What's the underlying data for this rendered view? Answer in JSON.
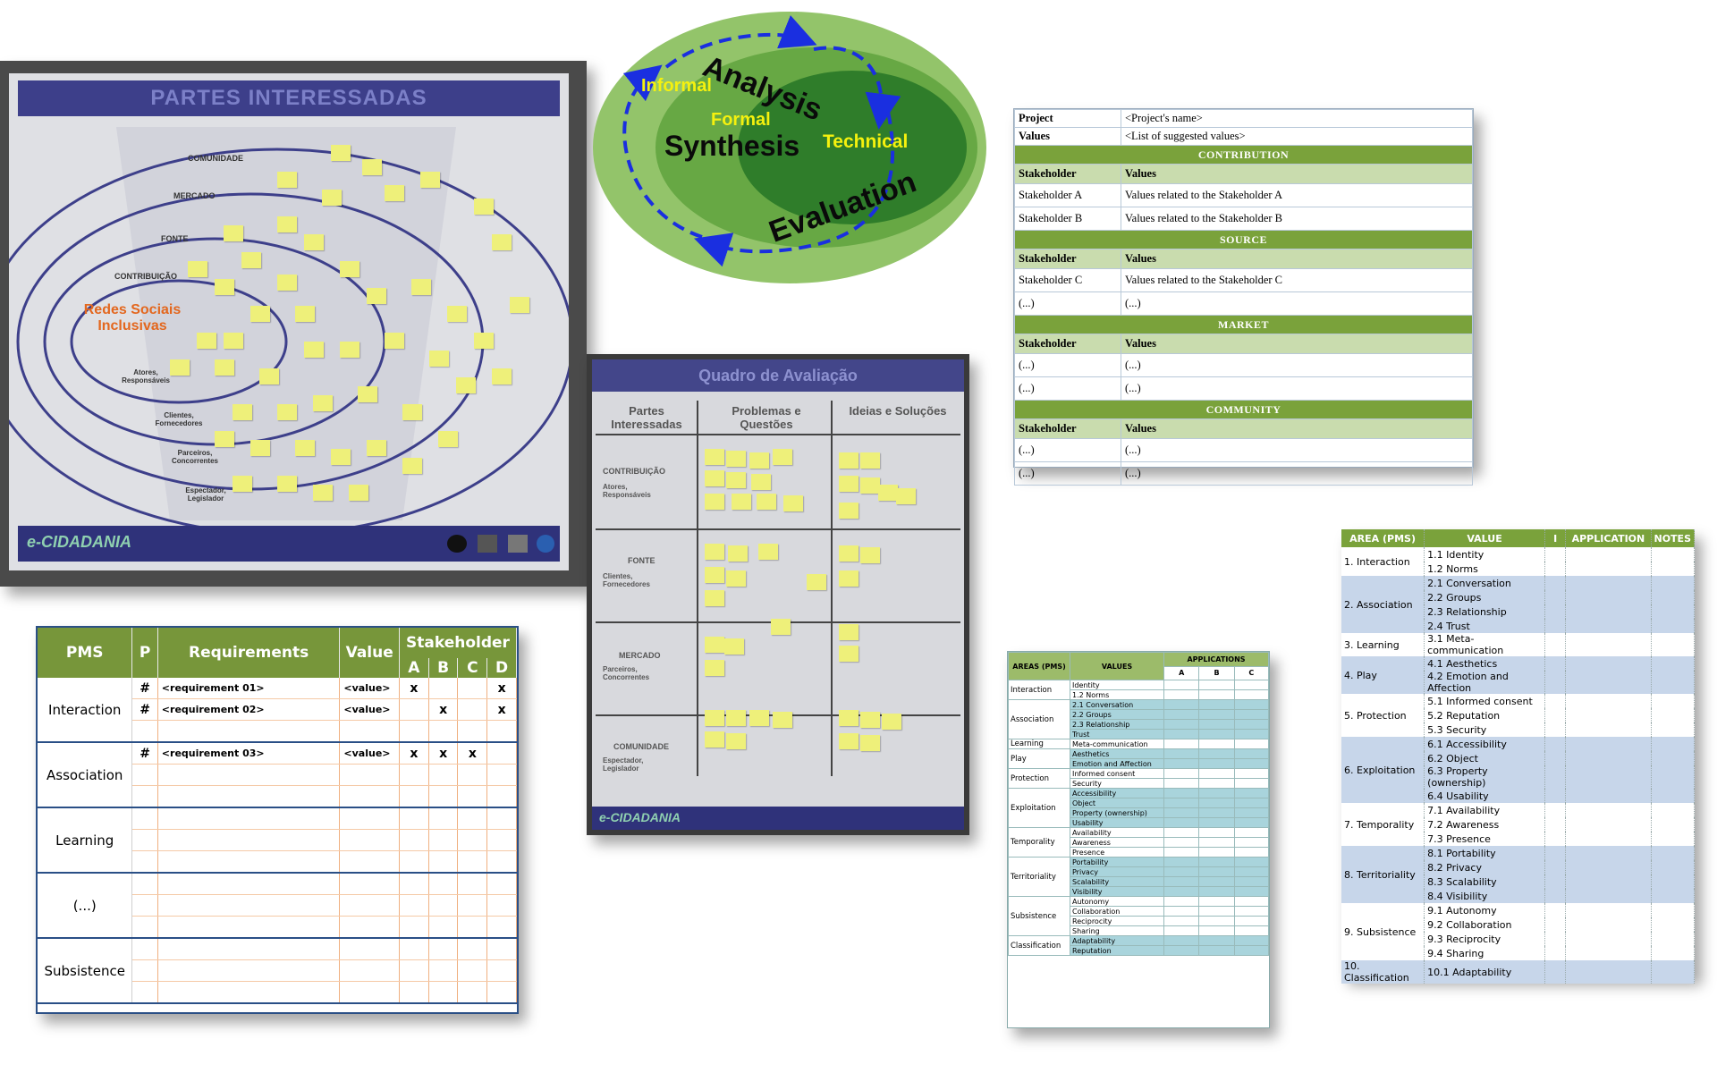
{
  "photo_board1": {
    "banner": "PARTES INTERESSADAS",
    "ring_labels": [
      "COMUNIDADE",
      "MERCADO",
      "FONTE",
      "CONTRIBUIÇÃO"
    ],
    "center_label": "Redes Sociais Inclusivas",
    "side_labels": [
      "Atores, Responsáveis",
      "Clientes, Fornecedores",
      "Parceiros, Concorrentes",
      "Espectador, Legislador"
    ],
    "logo": "e-CIDADANIA"
  },
  "diagram": {
    "outer": "Informal",
    "middle": "Formal",
    "inner": "Technical",
    "center": "Synthesis",
    "top": "Analysis",
    "bottom": "Evaluation",
    "colors": {
      "outer": "#93c46a",
      "middle": "#67a844",
      "inner": "#2f7d2a",
      "arrow": "#1a2fe0",
      "yellow": "#f5f10e"
    }
  },
  "photo_board2": {
    "banner": "Quadro de Avaliação",
    "col_headers": [
      "Partes Interessadas",
      "Problemas e Questões",
      "Ideias e Soluções"
    ],
    "rows": [
      {
        "title": "CONTRIBUIÇÃO",
        "sub": "Atores, Responsáveis"
      },
      {
        "title": "FONTE",
        "sub": "Clientes, Fornecedores"
      },
      {
        "title": "MERCADO",
        "sub": "Parceiros, Concorrentes"
      },
      {
        "title": "COMUNIDADE",
        "sub": "Espectador, Legislador"
      }
    ],
    "logo": "e-CIDADANIA"
  },
  "values_table": {
    "project_label": "Project",
    "project_value": "<Project's name>",
    "values_label": "Values",
    "values_value": "<List of suggested values>",
    "col1": "Stakeholder",
    "col2": "Values",
    "sections": [
      {
        "title": "CONTRIBUTION",
        "rows": [
          [
            "Stakeholder A",
            "Values related to the Stakeholder A"
          ],
          [
            "Stakeholder B",
            "Values related to the Stakeholder B"
          ]
        ]
      },
      {
        "title": "SOURCE",
        "rows": [
          [
            "Stakeholder C",
            "Values related to the Stakeholder C"
          ],
          [
            "(...)",
            "(...)"
          ]
        ]
      },
      {
        "title": "MARKET",
        "rows": [
          [
            "(...)",
            "(...)"
          ],
          [
            "(...)",
            "(...)"
          ]
        ]
      },
      {
        "title": "COMMUNITY",
        "rows": [
          [
            "(...)",
            "(...)"
          ],
          [
            "(...)",
            "(...)"
          ]
        ]
      }
    ]
  },
  "req_table": {
    "headers": {
      "pms": "PMS",
      "p": "P",
      "req": "Requirements",
      "value": "Value",
      "stakeholder": "Stakeholder",
      "a": "A",
      "b": "B",
      "c": "C",
      "d": "D"
    },
    "groups": [
      {
        "pms": "Interaction",
        "rows": [
          {
            "p": "#",
            "req": "<requirement 01>",
            "value": "<value>",
            "a": "x",
            "b": "",
            "c": "",
            "d": "x"
          },
          {
            "p": "#",
            "req": "<requirement 02>",
            "value": "<value>",
            "a": "",
            "b": "x",
            "c": "",
            "d": "x"
          },
          {
            "p": "",
            "req": "",
            "value": "",
            "a": "",
            "b": "",
            "c": "",
            "d": ""
          }
        ]
      },
      {
        "pms": "Association",
        "rows": [
          {
            "p": "#",
            "req": "<requirement 03>",
            "value": "<value>",
            "a": "x",
            "b": "x",
            "c": "x",
            "d": ""
          },
          {
            "p": "",
            "req": "",
            "value": "",
            "a": "",
            "b": "",
            "c": "",
            "d": ""
          },
          {
            "p": "",
            "req": "",
            "value": "",
            "a": "",
            "b": "",
            "c": "",
            "d": ""
          }
        ]
      },
      {
        "pms": "Learning",
        "rows": [
          {
            "p": "",
            "req": "",
            "value": "",
            "a": "",
            "b": "",
            "c": "",
            "d": ""
          },
          {
            "p": "",
            "req": "",
            "value": "",
            "a": "",
            "b": "",
            "c": "",
            "d": ""
          },
          {
            "p": "",
            "req": "",
            "value": "",
            "a": "",
            "b": "",
            "c": "",
            "d": ""
          }
        ]
      },
      {
        "pms": "(...)",
        "rows": [
          {
            "p": "",
            "req": "",
            "value": "",
            "a": "",
            "b": "",
            "c": "",
            "d": ""
          },
          {
            "p": "",
            "req": "",
            "value": "",
            "a": "",
            "b": "",
            "c": "",
            "d": ""
          },
          {
            "p": "",
            "req": "",
            "value": "",
            "a": "",
            "b": "",
            "c": "",
            "d": ""
          }
        ]
      },
      {
        "pms": "Subsistence",
        "rows": [
          {
            "p": "",
            "req": "",
            "value": "",
            "a": "",
            "b": "",
            "c": "",
            "d": ""
          },
          {
            "p": "",
            "req": "",
            "value": "",
            "a": "",
            "b": "",
            "c": "",
            "d": ""
          },
          {
            "p": "",
            "req": "",
            "value": "",
            "a": "",
            "b": "",
            "c": "",
            "d": ""
          }
        ]
      }
    ]
  },
  "app_table_small": {
    "headers": {
      "area": "AREAS (PMS)",
      "values": "VALUES",
      "applications": "APPLICATIONS",
      "a": "A",
      "b": "B",
      "c": "C"
    },
    "groups": [
      {
        "area": "Interaction",
        "values": [
          "Identity",
          "1.2 Norms"
        ]
      },
      {
        "area": "Association",
        "values": [
          "2.1 Conversation",
          "2.2 Groups",
          "2.3 Relationship",
          "Trust"
        ]
      },
      {
        "area": "Learning",
        "values": [
          "Meta-communication"
        ]
      },
      {
        "area": "Play",
        "values": [
          "Aesthetics",
          "Emotion and Affection"
        ]
      },
      {
        "area": "Protection",
        "values": [
          "Informed consent",
          "Security"
        ]
      },
      {
        "area": "Exploitation",
        "values": [
          "Accessibility",
          "Object",
          "Property (ownership)",
          "Usability"
        ]
      },
      {
        "area": "Temporality",
        "values": [
          "Availability",
          "Awareness",
          "Presence"
        ]
      },
      {
        "area": "Territoriality",
        "values": [
          "Portability",
          "Privacy",
          "Scalability",
          "Visibility"
        ]
      },
      {
        "area": "Subsistence",
        "values": [
          "Autonomy",
          "Collaboration",
          "Reciprocity",
          "Sharing"
        ]
      },
      {
        "area": "Classification",
        "values": [
          "Adaptability",
          "Reputation"
        ]
      }
    ]
  },
  "app_table_large": {
    "headers": {
      "area": "AREA (PMS)",
      "value": "VALUE",
      "i": "I",
      "application": "APPLICATION",
      "notes": "NOTES"
    },
    "groups": [
      {
        "area": "1. Interaction",
        "values": [
          "1.1 Identity",
          "1.2 Norms"
        ]
      },
      {
        "area": "2. Association",
        "values": [
          "2.1 Conversation",
          "2.2 Groups",
          "2.3 Relationship",
          "2.4 Trust"
        ]
      },
      {
        "area": "3. Learning",
        "values": [
          "3.1 Meta-communication"
        ]
      },
      {
        "area": "4. Play",
        "values": [
          "4.1 Aesthetics",
          "4.2 Emotion and Affection"
        ]
      },
      {
        "area": "5. Protection",
        "values": [
          "5.1 Informed consent",
          "5.2 Reputation",
          "5.3 Security"
        ]
      },
      {
        "area": "6. Exploitation",
        "values": [
          "6.1 Accessibility",
          "6.2 Object",
          "6.3 Property (ownership)",
          "6.4 Usability"
        ]
      },
      {
        "area": "7. Temporality",
        "values": [
          "7.1 Availability",
          "7.2 Awareness",
          "7.3 Presence"
        ]
      },
      {
        "area": "8. Territoriality",
        "values": [
          "8.1 Portability",
          "8.2 Privacy",
          "8.3 Scalability",
          "8.4 Visibility"
        ]
      },
      {
        "area": "9. Subsistence",
        "values": [
          "9.1 Autonomy",
          "9.2 Collaboration",
          "9.3 Reciprocity",
          "9.4 Sharing"
        ]
      },
      {
        "area": "10. Classification",
        "values": [
          "10.1 Adaptability"
        ]
      }
    ]
  }
}
